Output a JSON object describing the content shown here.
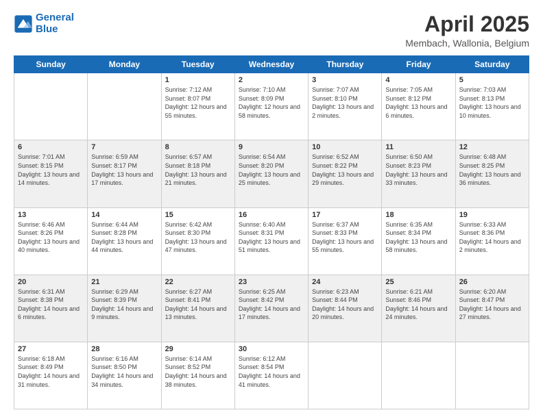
{
  "header": {
    "logo_line1": "General",
    "logo_line2": "Blue",
    "month": "April 2025",
    "location": "Membach, Wallonia, Belgium"
  },
  "weekdays": [
    "Sunday",
    "Monday",
    "Tuesday",
    "Wednesday",
    "Thursday",
    "Friday",
    "Saturday"
  ],
  "weeks": [
    [
      {
        "day": "",
        "info": ""
      },
      {
        "day": "",
        "info": ""
      },
      {
        "day": "1",
        "info": "Sunrise: 7:12 AM\nSunset: 8:07 PM\nDaylight: 12 hours and 55 minutes."
      },
      {
        "day": "2",
        "info": "Sunrise: 7:10 AM\nSunset: 8:09 PM\nDaylight: 12 hours and 58 minutes."
      },
      {
        "day": "3",
        "info": "Sunrise: 7:07 AM\nSunset: 8:10 PM\nDaylight: 13 hours and 2 minutes."
      },
      {
        "day": "4",
        "info": "Sunrise: 7:05 AM\nSunset: 8:12 PM\nDaylight: 13 hours and 6 minutes."
      },
      {
        "day": "5",
        "info": "Sunrise: 7:03 AM\nSunset: 8:13 PM\nDaylight: 13 hours and 10 minutes."
      }
    ],
    [
      {
        "day": "6",
        "info": "Sunrise: 7:01 AM\nSunset: 8:15 PM\nDaylight: 13 hours and 14 minutes."
      },
      {
        "day": "7",
        "info": "Sunrise: 6:59 AM\nSunset: 8:17 PM\nDaylight: 13 hours and 17 minutes."
      },
      {
        "day": "8",
        "info": "Sunrise: 6:57 AM\nSunset: 8:18 PM\nDaylight: 13 hours and 21 minutes."
      },
      {
        "day": "9",
        "info": "Sunrise: 6:54 AM\nSunset: 8:20 PM\nDaylight: 13 hours and 25 minutes."
      },
      {
        "day": "10",
        "info": "Sunrise: 6:52 AM\nSunset: 8:22 PM\nDaylight: 13 hours and 29 minutes."
      },
      {
        "day": "11",
        "info": "Sunrise: 6:50 AM\nSunset: 8:23 PM\nDaylight: 13 hours and 33 minutes."
      },
      {
        "day": "12",
        "info": "Sunrise: 6:48 AM\nSunset: 8:25 PM\nDaylight: 13 hours and 36 minutes."
      }
    ],
    [
      {
        "day": "13",
        "info": "Sunrise: 6:46 AM\nSunset: 8:26 PM\nDaylight: 13 hours and 40 minutes."
      },
      {
        "day": "14",
        "info": "Sunrise: 6:44 AM\nSunset: 8:28 PM\nDaylight: 13 hours and 44 minutes."
      },
      {
        "day": "15",
        "info": "Sunrise: 6:42 AM\nSunset: 8:30 PM\nDaylight: 13 hours and 47 minutes."
      },
      {
        "day": "16",
        "info": "Sunrise: 6:40 AM\nSunset: 8:31 PM\nDaylight: 13 hours and 51 minutes."
      },
      {
        "day": "17",
        "info": "Sunrise: 6:37 AM\nSunset: 8:33 PM\nDaylight: 13 hours and 55 minutes."
      },
      {
        "day": "18",
        "info": "Sunrise: 6:35 AM\nSunset: 8:34 PM\nDaylight: 13 hours and 58 minutes."
      },
      {
        "day": "19",
        "info": "Sunrise: 6:33 AM\nSunset: 8:36 PM\nDaylight: 14 hours and 2 minutes."
      }
    ],
    [
      {
        "day": "20",
        "info": "Sunrise: 6:31 AM\nSunset: 8:38 PM\nDaylight: 14 hours and 6 minutes."
      },
      {
        "day": "21",
        "info": "Sunrise: 6:29 AM\nSunset: 8:39 PM\nDaylight: 14 hours and 9 minutes."
      },
      {
        "day": "22",
        "info": "Sunrise: 6:27 AM\nSunset: 8:41 PM\nDaylight: 14 hours and 13 minutes."
      },
      {
        "day": "23",
        "info": "Sunrise: 6:25 AM\nSunset: 8:42 PM\nDaylight: 14 hours and 17 minutes."
      },
      {
        "day": "24",
        "info": "Sunrise: 6:23 AM\nSunset: 8:44 PM\nDaylight: 14 hours and 20 minutes."
      },
      {
        "day": "25",
        "info": "Sunrise: 6:21 AM\nSunset: 8:46 PM\nDaylight: 14 hours and 24 minutes."
      },
      {
        "day": "26",
        "info": "Sunrise: 6:20 AM\nSunset: 8:47 PM\nDaylight: 14 hours and 27 minutes."
      }
    ],
    [
      {
        "day": "27",
        "info": "Sunrise: 6:18 AM\nSunset: 8:49 PM\nDaylight: 14 hours and 31 minutes."
      },
      {
        "day": "28",
        "info": "Sunrise: 6:16 AM\nSunset: 8:50 PM\nDaylight: 14 hours and 34 minutes."
      },
      {
        "day": "29",
        "info": "Sunrise: 6:14 AM\nSunset: 8:52 PM\nDaylight: 14 hours and 38 minutes."
      },
      {
        "day": "30",
        "info": "Sunrise: 6:12 AM\nSunset: 8:54 PM\nDaylight: 14 hours and 41 minutes."
      },
      {
        "day": "",
        "info": ""
      },
      {
        "day": "",
        "info": ""
      },
      {
        "day": "",
        "info": ""
      }
    ]
  ]
}
